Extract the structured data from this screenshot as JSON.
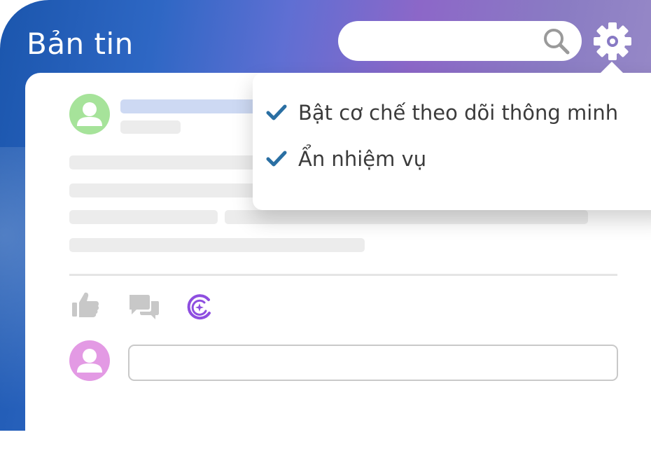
{
  "header": {
    "title": "Bản tin",
    "search_placeholder": "",
    "search_icon": "search-icon",
    "settings_icon": "gear-icon"
  },
  "settings_menu": {
    "items": [
      {
        "label": "Bật cơ chế theo dõi thông minh",
        "checked": true
      },
      {
        "label": "Ẩn nhiệm vụ",
        "checked": true
      }
    ]
  },
  "post": {
    "author_avatar_color": "#a6e39a",
    "actions": [
      {
        "icon": "like-icon"
      },
      {
        "icon": "comment-icon"
      },
      {
        "icon": "ai-assistant-icon",
        "color": "#8e4ee0"
      }
    ],
    "commenter_avatar_color": "#e39ae4",
    "comment_placeholder": ""
  },
  "colors": {
    "accent": "#2a6fa3",
    "title_placeholder": "#cdd9f3",
    "skeleton": "#ececec"
  }
}
